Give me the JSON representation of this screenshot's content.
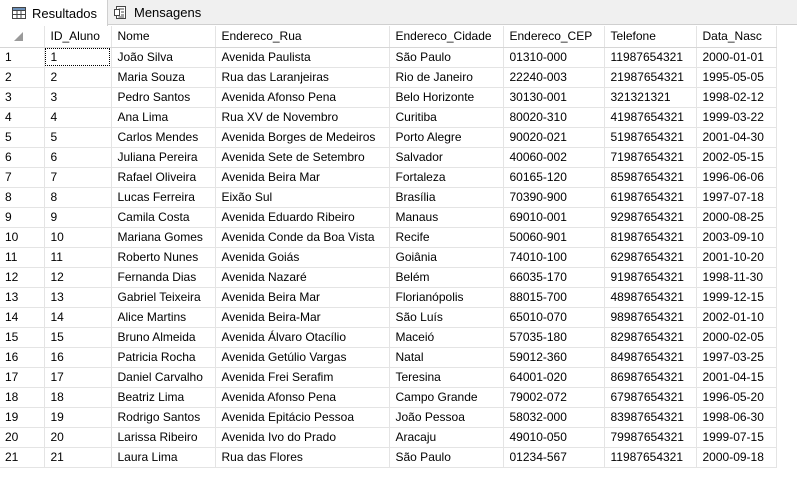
{
  "tabs": [
    {
      "label": "Resultados",
      "icon": "grid-results-icon",
      "active": true
    },
    {
      "label": "Mensagens",
      "icon": "messages-icon",
      "active": false
    }
  ],
  "grid": {
    "columns": [
      "",
      "ID_Aluno",
      "Nome",
      "Endereco_Rua",
      "Endereco_Cidade",
      "Endereco_CEP",
      "Telefone",
      "Data_Nasc"
    ],
    "rows": [
      [
        "1",
        "1",
        "João Silva",
        "Avenida Paulista",
        "São Paulo",
        "01310-000",
        "11987654321",
        "2000-01-01"
      ],
      [
        "2",
        "2",
        "Maria Souza",
        "Rua das Laranjeiras",
        "Rio de Janeiro",
        "22240-003",
        "21987654321",
        "1995-05-05"
      ],
      [
        "3",
        "3",
        "Pedro Santos",
        "Avenida Afonso Pena",
        "Belo Horizonte",
        "30130-001",
        "321321321",
        "1998-02-12"
      ],
      [
        "4",
        "4",
        "Ana Lima",
        "Rua XV de Novembro",
        "Curitiba",
        "80020-310",
        "41987654321",
        "1999-03-22"
      ],
      [
        "5",
        "5",
        "Carlos Mendes",
        "Avenida Borges de Medeiros",
        "Porto Alegre",
        "90020-021",
        "51987654321",
        "2001-04-30"
      ],
      [
        "6",
        "6",
        "Juliana Pereira",
        "Avenida Sete de Setembro",
        "Salvador",
        "40060-002",
        "71987654321",
        "2002-05-15"
      ],
      [
        "7",
        "7",
        "Rafael Oliveira",
        "Avenida Beira Mar",
        "Fortaleza",
        "60165-120",
        "85987654321",
        "1996-06-06"
      ],
      [
        "8",
        "8",
        "Lucas Ferreira",
        "Eixão Sul",
        "Brasília",
        "70390-900",
        "61987654321",
        "1997-07-18"
      ],
      [
        "9",
        "9",
        "Camila Costa",
        "Avenida Eduardo Ribeiro",
        "Manaus",
        "69010-001",
        "92987654321",
        "2000-08-25"
      ],
      [
        "10",
        "10",
        "Mariana Gomes",
        "Avenida Conde da Boa Vista",
        "Recife",
        "50060-901",
        "81987654321",
        "2003-09-10"
      ],
      [
        "11",
        "11",
        "Roberto Nunes",
        "Avenida Goiás",
        "Goiânia",
        "74010-100",
        "62987654321",
        "2001-10-20"
      ],
      [
        "12",
        "12",
        "Fernanda Dias",
        "Avenida Nazaré",
        "Belém",
        "66035-170",
        "91987654321",
        "1998-11-30"
      ],
      [
        "13",
        "13",
        "Gabriel Teixeira",
        "Avenida Beira Mar",
        "Florianópolis",
        "88015-700",
        "48987654321",
        "1999-12-15"
      ],
      [
        "14",
        "14",
        "Alice Martins",
        "Avenida Beira-Mar",
        "São Luís",
        "65010-070",
        "98987654321",
        "2002-01-10"
      ],
      [
        "15",
        "15",
        "Bruno Almeida",
        "Avenida Álvaro Otacílio",
        "Maceió",
        "57035-180",
        "82987654321",
        "2000-02-05"
      ],
      [
        "16",
        "16",
        "Patricia Rocha",
        "Avenida Getúlio Vargas",
        "Natal",
        "59012-360",
        "84987654321",
        "1997-03-25"
      ],
      [
        "17",
        "17",
        "Daniel Carvalho",
        "Avenida Frei Serafim",
        "Teresina",
        "64001-020",
        "86987654321",
        "2001-04-15"
      ],
      [
        "18",
        "18",
        "Beatriz Lima",
        "Avenida Afonso Pena",
        "Campo Grande",
        "79002-072",
        "67987654321",
        "1996-05-20"
      ],
      [
        "19",
        "19",
        "Rodrigo Santos",
        "Avenida Epitácio Pessoa",
        "João Pessoa",
        "58032-000",
        "83987654321",
        "1998-06-30"
      ],
      [
        "20",
        "20",
        "Larissa Ribeiro",
        "Avenida Ivo do Prado",
        "Aracaju",
        "49010-050",
        "79987654321",
        "1999-07-15"
      ],
      [
        "21",
        "21",
        "Laura Lima",
        "Rua das Flores",
        "São Paulo",
        "01234-567",
        "11987654321",
        "2000-09-18"
      ]
    ]
  }
}
